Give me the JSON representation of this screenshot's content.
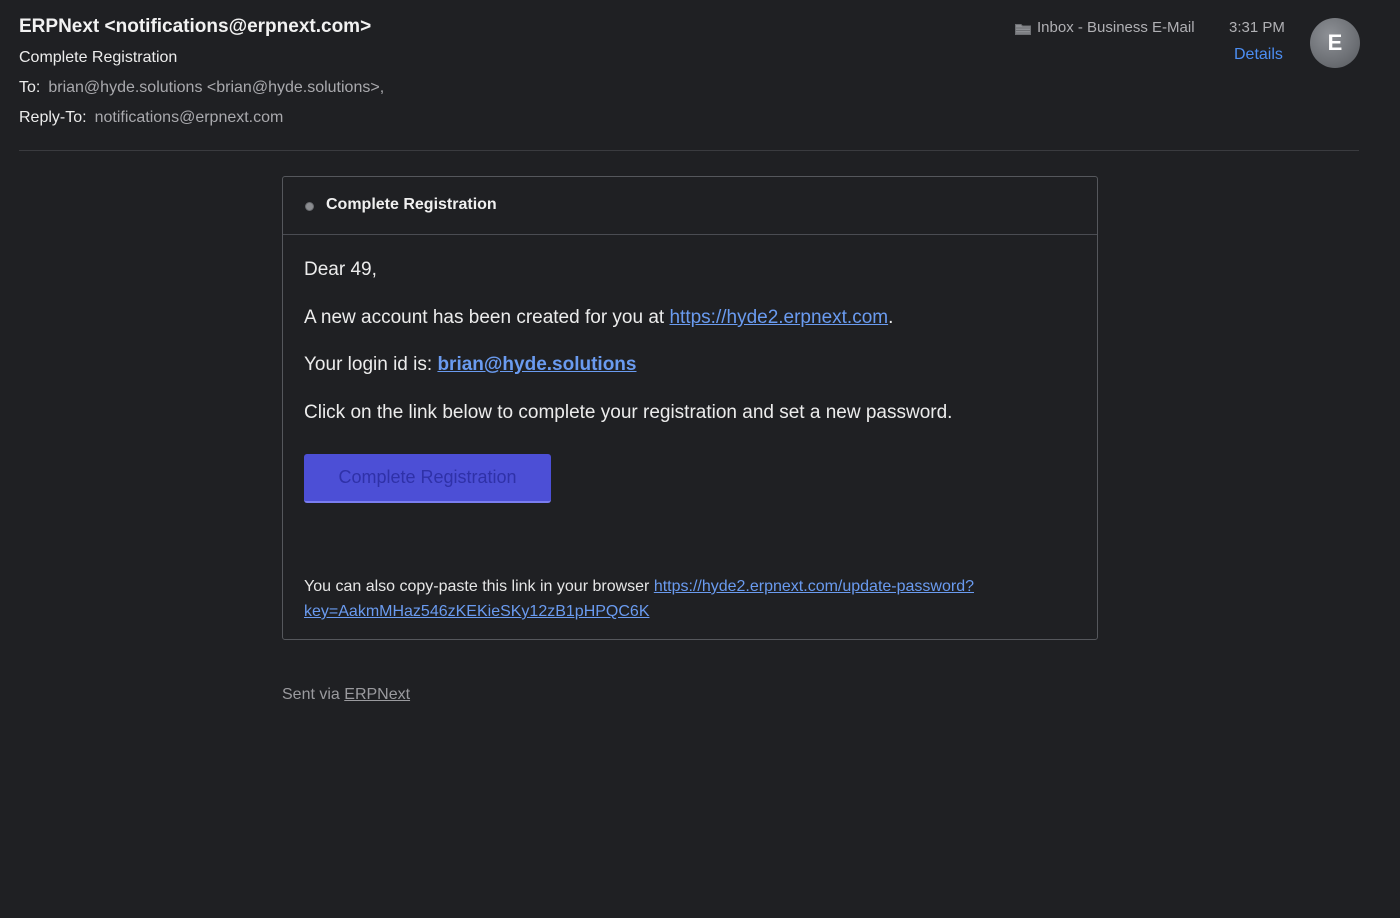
{
  "header": {
    "sender": "ERPNext <notifications@erpnext.com>",
    "subject": "Complete Registration",
    "to_label": "To:",
    "to_value": "brian@hyde.solutions <brian@hyde.solutions>,",
    "reply_to_label": "Reply-To:",
    "reply_to_value": "notifications@erpnext.com",
    "mailbox": "Inbox - Business E-Mail",
    "mailbox_icon": "folder-icon",
    "time": "3:31 PM",
    "details_label": "Details",
    "avatar_initial": "E"
  },
  "email": {
    "card_title": "Complete Registration",
    "greeting": "Dear 49,",
    "p1_prefix": "A new account has been created for you at ",
    "p1_link": "https://hyde2.erpnext.com",
    "p1_suffix": ".",
    "p2_prefix": "Your login id is: ",
    "p2_link": "brian@hyde.solutions",
    "p3": "Click on the link below to complete your registration and set a new password.",
    "button_label": "Complete Registration",
    "footnote_prefix": "You can also copy-paste this link in your browser ",
    "footnote_link": "https://hyde2.erpnext.com/update-password?key=AakmMHaz546zKEKieSKy12zB1pHPQC6K"
  },
  "footer": {
    "sent_via_prefix": "Sent via ",
    "sent_via_link": "ERPNext"
  },
  "colors": {
    "background": "#1f2023",
    "link": "#6a9bf0",
    "details": "#4c8ef3",
    "button": "#4c4fd6"
  }
}
